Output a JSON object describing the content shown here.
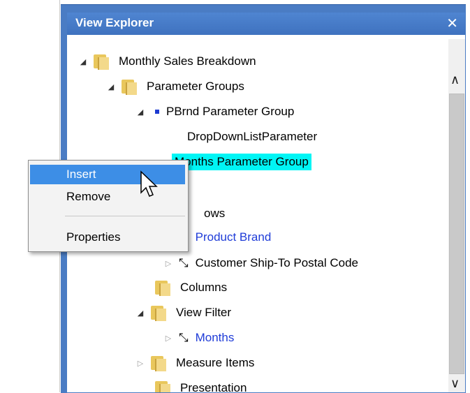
{
  "window": {
    "title": "View Explorer",
    "close_glyph": "✕"
  },
  "tree": {
    "items": [
      {
        "label": "Monthly Sales Breakdown",
        "icon": "folder-icon",
        "expander": "expanded"
      },
      {
        "label": "Parameter Groups",
        "icon": "folder-icon",
        "expander": "expanded"
      },
      {
        "label": "PBrnd Parameter Group",
        "icon": "dot-icon",
        "expander": "expanded"
      },
      {
        "label": "DropDownListParameter",
        "icon": "none"
      },
      {
        "label": "Months Parameter Group",
        "icon": "dot-icon",
        "selected": true
      },
      {
        "label": "ows",
        "icon": "none"
      },
      {
        "label": "Product Brand",
        "icon": "nav-icon",
        "expander": "collapsed",
        "link": true
      },
      {
        "label": "Customer Ship-To Postal Code",
        "icon": "nav-icon",
        "expander": "collapsed"
      },
      {
        "label": "Columns",
        "icon": "folder-icon"
      },
      {
        "label": "View Filter",
        "icon": "folder-icon",
        "expander": "expanded"
      },
      {
        "label": "Months",
        "icon": "nav-icon",
        "expander": "collapsed",
        "link": true
      },
      {
        "label": "Measure Items",
        "icon": "folder-icon",
        "expander": "collapsed"
      },
      {
        "label": "Presentation",
        "icon": "folder-icon"
      }
    ]
  },
  "context_menu": {
    "insert": "Insert",
    "remove": "Remove",
    "properties": "Properties"
  },
  "colors": {
    "titlebar": "#3f72bf",
    "selection": "#00f5f5",
    "link": "#1f3cd8",
    "menu_highlight": "#3d8ee6"
  }
}
